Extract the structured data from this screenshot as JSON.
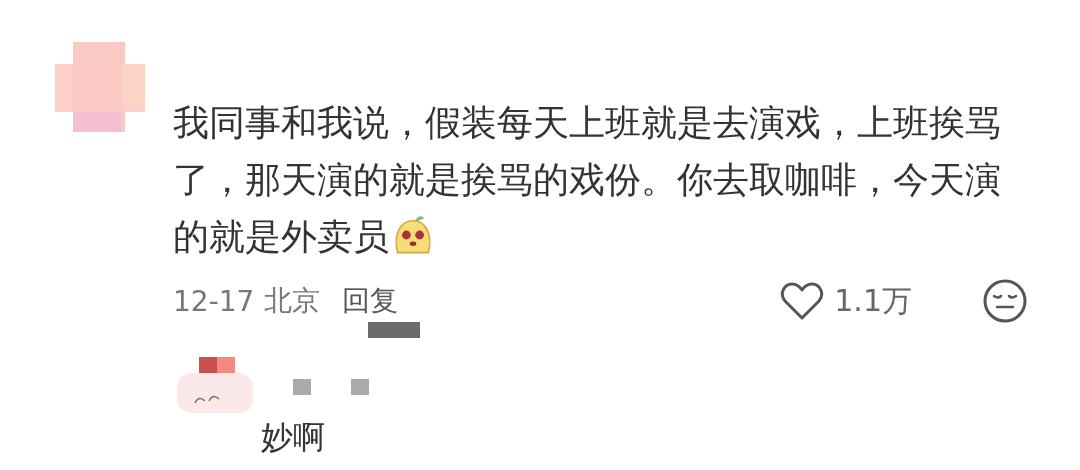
{
  "comment": {
    "text": "我同事和我说，假装每天上班就是去演戏，上班挨骂了，那天演的就是挨骂的戏份。你去取咖啡，今天演的就是外卖员",
    "date": "12-17",
    "location": "北京",
    "reply_label": "回复",
    "likes": "1.1万"
  },
  "replies": [
    {
      "text": "妙啊"
    }
  ]
}
